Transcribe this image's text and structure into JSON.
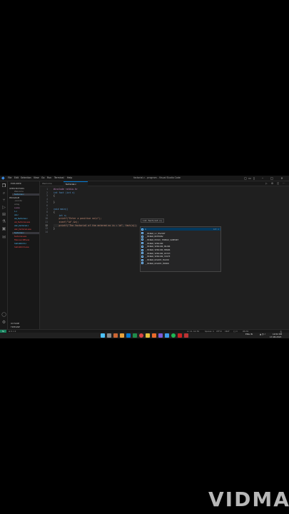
{
  "window": {
    "title": "factorial.c - program - Visual Studio Code",
    "menu": [
      "File",
      "Edit",
      "Selection",
      "View",
      "Go",
      "Run",
      "Terminal",
      "Help"
    ]
  },
  "sidebar": {
    "header": "EXPLORER",
    "section_open": "OPEN EDITORS",
    "open_files": [
      "Welcome",
      "factorial.c"
    ],
    "section_folder": "PROGRAM",
    "items": [
      ".vscode",
      "array",
      "a.exe",
      "1.c",
      "ab.c",
      "ab_factorial.c",
      "ab_factorial.exe",
      "abc_factorial.c",
      "abc_factorial.exe",
      "factorial.c",
      "factorial.exe",
      "fibonacciPP.exe",
      "helloWorld.c",
      "helloWorld.exe"
    ],
    "outline": "OUTLINE",
    "timeline": "TIMELINE"
  },
  "tabs": [
    {
      "label": "Welcome"
    },
    {
      "label": "factorial.c"
    }
  ],
  "editor": {
    "line_numbers": [
      "1",
      "2",
      "3",
      "4",
      "5",
      "6",
      "7",
      "8",
      "9",
      "10",
      "11",
      "12",
      "13",
      "14"
    ],
    "lines": [
      "#include <stdio.h>",
      "int fact (int n)",
      "{",
      "",
      "}",
      "",
      "void main()",
      "{",
      "    int n;",
      "    printf(\"Enter a positive no\\n\");",
      "    scanf(\"%d\",&n);",
      "    printf(\"The factorial of the entered no is = %d\", fact(n));",
      "}",
      ""
    ]
  },
  "hint": "int fact(int n)",
  "suggestions": {
    "detail": "int n",
    "items": [
      "n",
      "__MINGW_LC_MSVCRT",
      "__MINGW_NOTHROW",
      "__MINGW_POSIX_THREAD_SUPPORT",
      "__MINGW_VERSION",
      "__MINGW_VERSION_MAJOR",
      "__MINGW_VERSION_MINOR",
      "__MINGW_VERSION_PATCH",
      "__MINGW_VERSION_STATE",
      "__MINGW_W32API_MAJOR",
      "__MINGW_W32API_MINOR"
    ]
  },
  "statusbar": {
    "left": "⊗ 0 ⚠ 0",
    "items": [
      "Ln 12, Col 56",
      "Spaces: 4",
      "UTF-8",
      "CRLF",
      "{} C",
      "Win32"
    ]
  },
  "taskbar": {
    "time": "10:52 PM",
    "date": "17-08-2023",
    "lang": "ENG IN"
  },
  "watermark": "VIDMA",
  "colors": {
    "accent": "#0078d4",
    "status_remote": "#16825d",
    "editor_bg": "#1f1f1f"
  }
}
